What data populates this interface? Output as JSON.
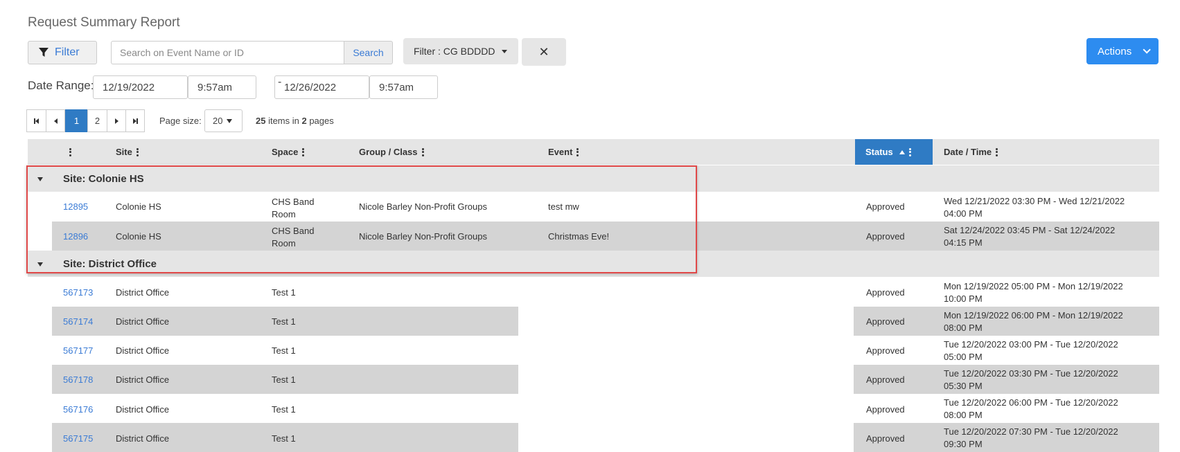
{
  "header": {
    "title": "Request Summary Report"
  },
  "toolbar": {
    "filter_label": "Filter",
    "search_placeholder": "Search on Event Name or ID",
    "search_value": "",
    "search_button": "Search",
    "filter_dropdown": "Filter : CG BDDDD",
    "clear_icon": "✕",
    "actions_label": "Actions"
  },
  "date_range": {
    "label": "Date Range:",
    "start_date": "12/19/2022",
    "start_time": "9:57am",
    "separator": "-",
    "end_date": "12/26/2022",
    "end_time": "9:57am"
  },
  "pager": {
    "pages": [
      "1",
      "2"
    ],
    "current_page": "1",
    "page_size_label": "Page size:",
    "page_size": "20",
    "items_count": "25",
    "items_text_mid": " items in ",
    "pages_count": "2",
    "items_text_end": " pages"
  },
  "grid": {
    "columns": {
      "site": "Site",
      "space": "Space",
      "group": "Group / Class",
      "event": "Event",
      "status": "Status",
      "datetime": "Date / Time"
    },
    "groups": [
      {
        "label": "Site: Colonie HS"
      },
      {
        "label": "Site: District Office"
      }
    ],
    "rows": [
      {
        "id": "12895",
        "site": "Colonie HS",
        "space_1": "CHS Band",
        "space_2": "Room",
        "group": "Nicole Barley Non-Profit Groups",
        "event": "test mw",
        "status": "Approved",
        "dt_1": "Wed 12/21/2022 03:30 PM - Wed 12/21/2022",
        "dt_2": "04:00 PM"
      },
      {
        "id": "12896",
        "site": "Colonie HS",
        "space_1": "CHS Band",
        "space_2": "Room",
        "group": "Nicole Barley Non-Profit Groups",
        "event": "Christmas Eve!",
        "status": "Approved",
        "dt_1": "Sat 12/24/2022 03:45 PM - Sat 12/24/2022",
        "dt_2": "04:15 PM"
      },
      {
        "id": "567173",
        "site": "District Office",
        "space": "Test 1",
        "status": "Approved",
        "dt_1": "Mon 12/19/2022 05:00 PM - Mon 12/19/2022",
        "dt_2": "10:00 PM"
      },
      {
        "id": "567174",
        "site": "District Office",
        "space": "Test 1",
        "status": "Approved",
        "dt_1": "Mon 12/19/2022 06:00 PM - Mon 12/19/2022",
        "dt_2": "08:00 PM"
      },
      {
        "id": "567177",
        "site": "District Office",
        "space": "Test 1",
        "status": "Approved",
        "dt_1": "Tue 12/20/2022 03:00 PM - Tue 12/20/2022",
        "dt_2": "05:00 PM"
      },
      {
        "id": "567178",
        "site": "District Office",
        "space": "Test 1",
        "status": "Approved",
        "dt_1": "Tue 12/20/2022 03:30 PM - Tue 12/20/2022",
        "dt_2": "05:30 PM"
      },
      {
        "id": "567176",
        "site": "District Office",
        "space": "Test 1",
        "status": "Approved",
        "dt_1": "Tue 12/20/2022 06:00 PM - Tue 12/20/2022",
        "dt_2": "08:00 PM"
      },
      {
        "id": "567175",
        "site": "District Office",
        "space": "Test 1",
        "status": "Approved",
        "dt_1": "Tue 12/20/2022 07:30 PM - Tue 12/20/2022",
        "dt_2": "09:30 PM"
      }
    ]
  },
  "colors": {
    "accent": "#2f7bc4",
    "actions": "#2d8cf0",
    "link": "#3a7bd5",
    "highlight": "#e04848",
    "row_alt": "#d4d4d4",
    "header_bg": "#e5e5e5"
  }
}
